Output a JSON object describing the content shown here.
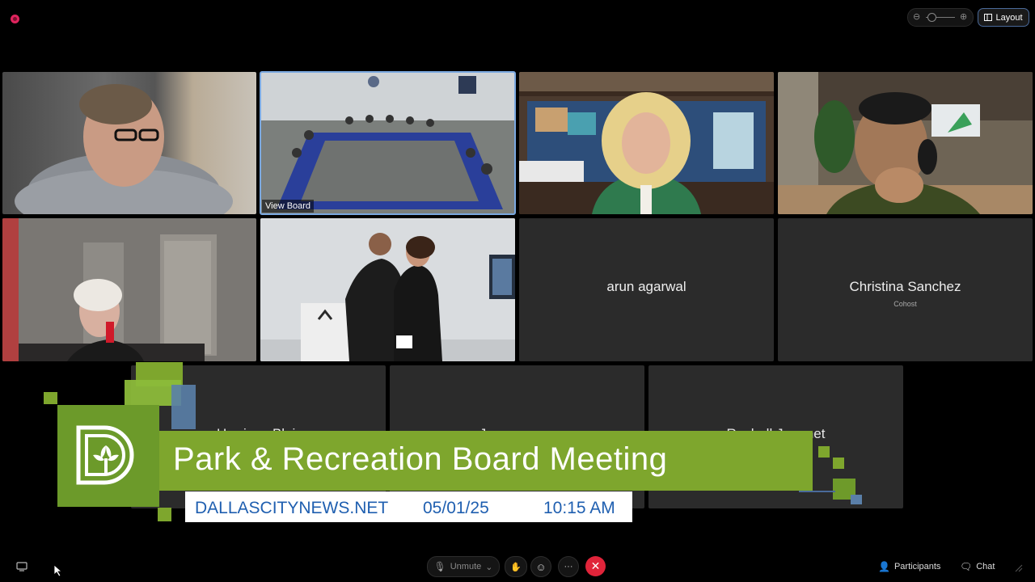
{
  "topbar": {
    "layout_label": "Layout",
    "zoom_out_icon": "zoom-out-icon",
    "zoom_in_icon": "zoom-in-icon"
  },
  "tiles": {
    "view_board_label": "View Board",
    "arun": {
      "name": "arun agarwal"
    },
    "christina": {
      "name": "Christina Sanchez",
      "role": "Cohost"
    },
    "row3": [
      {
        "name": "Harrison Blair"
      },
      {
        "name": "Jane conner"
      },
      {
        "name": "Rashell Jeannet"
      }
    ]
  },
  "banner": {
    "title": "Park & Recreation Board Meeting",
    "website": "DALLASCITYNEWS.NET",
    "date": "05/01/25",
    "time": "10:15 AM"
  },
  "bottombar": {
    "unmute_label": "Unmute",
    "participants_label": "Participants",
    "chat_label": "Chat",
    "more_label": "···"
  },
  "colors": {
    "banner_green": "#7ea62d",
    "banner_text_blue": "#1f5fb0",
    "end_call_red": "#e0243a",
    "active_tile_outline": "#7aa8e0"
  }
}
